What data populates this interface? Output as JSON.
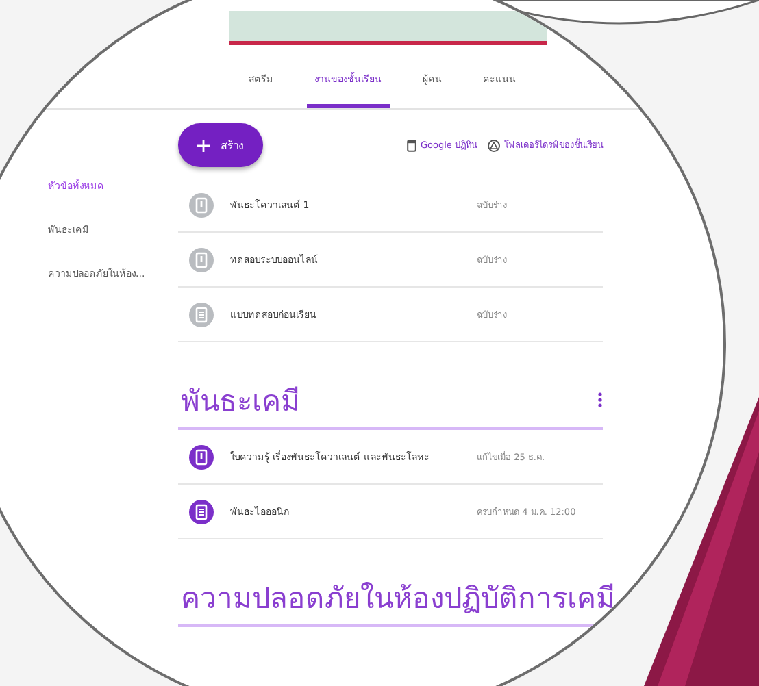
{
  "tabs": [
    {
      "label": "สตรีม",
      "selected": false
    },
    {
      "label": "งานของชั้นเรียน",
      "selected": true
    },
    {
      "label": "ผู้คน",
      "selected": false
    },
    {
      "label": "คะแนน",
      "selected": false
    }
  ],
  "create_button": {
    "label": "สร้าง"
  },
  "links": [
    {
      "kind": "calendar",
      "label": "Google ปฏิทิน"
    },
    {
      "kind": "drive",
      "label": "โฟลเดอร์ไดรฟ์ของชั้นเรียน"
    }
  ],
  "sidebar": {
    "items": [
      {
        "label": "หัวข้อทั้งหมด",
        "selected": true
      },
      {
        "label": "พันธะเคมี",
        "selected": false
      },
      {
        "label": "ความปลอดภัยในห้อง...",
        "selected": false
      }
    ]
  },
  "items": [
    {
      "kind": "assignment",
      "title": "พันธะโควาเลนต์ 1",
      "meta": "ฉบับร่าง",
      "draft": true
    },
    {
      "kind": "assignment",
      "title": "ทดสอบระบบออนไลน์",
      "meta": "ฉบับร่าง",
      "draft": true
    },
    {
      "kind": "quiz",
      "title": "แบบทดสอบก่อนเรียน",
      "meta": "ฉบับร่าง",
      "draft": true
    }
  ],
  "sections": [
    {
      "title": "พันธะเคมี",
      "items": [
        {
          "kind": "assignment",
          "title": "ใบความรู้ เรื่องพันธะโควาเลนต์ และพันธะโลหะ",
          "meta": "แก้ไขเมื่อ 25 ธ.ค.",
          "draft": false
        },
        {
          "kind": "quiz",
          "title": "พันธะไอออนิก",
          "meta": "ครบกำหนด 4 ม.ค. 12:00",
          "draft": false
        }
      ]
    },
    {
      "title": "ความปลอดภัยในห้องปฏิบัติการเคมี"
    }
  ]
}
